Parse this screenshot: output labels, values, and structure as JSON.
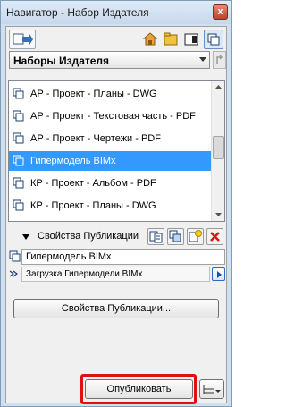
{
  "window": {
    "title": "Навигатор - Набор Издателя",
    "close_glyph": "x"
  },
  "toolbar": {
    "left_icon": "publisher-arrow-icon",
    "view_icons": [
      "project-map-icon",
      "view-map-icon",
      "layout-book-icon",
      "publisher-sets-icon"
    ]
  },
  "combo": {
    "label": "Наборы Издателя"
  },
  "list": {
    "items": [
      {
        "label": "АР - Проект - Планы - DWG",
        "selected": false
      },
      {
        "label": "АР - Проект - Текстовая часть - PDF",
        "selected": false
      },
      {
        "label": "АР - Проект - Чертежи - PDF",
        "selected": false
      },
      {
        "label": "Гипермодель BIMx",
        "selected": true
      },
      {
        "label": "КР - Проект - Альбом - PDF",
        "selected": false
      },
      {
        "label": "КР - Проект - Планы - DWG",
        "selected": false
      }
    ]
  },
  "actions": {
    "icons": [
      "new-set-icon",
      "duplicate-set-icon",
      "new-item-icon",
      "delete-icon"
    ]
  },
  "properties": {
    "section_title": "Свойства Публикации",
    "name_value": "Гипермодель BIMx",
    "load_text": "Загрузка Гипермодели BIMx",
    "properties_button": "Свойства Публикации..."
  },
  "footer": {
    "publish_button": "Опубликовать"
  },
  "colors": {
    "selection": "#3399ff",
    "highlight_box": "#e01010",
    "window_frame": "#cfe0f1"
  }
}
